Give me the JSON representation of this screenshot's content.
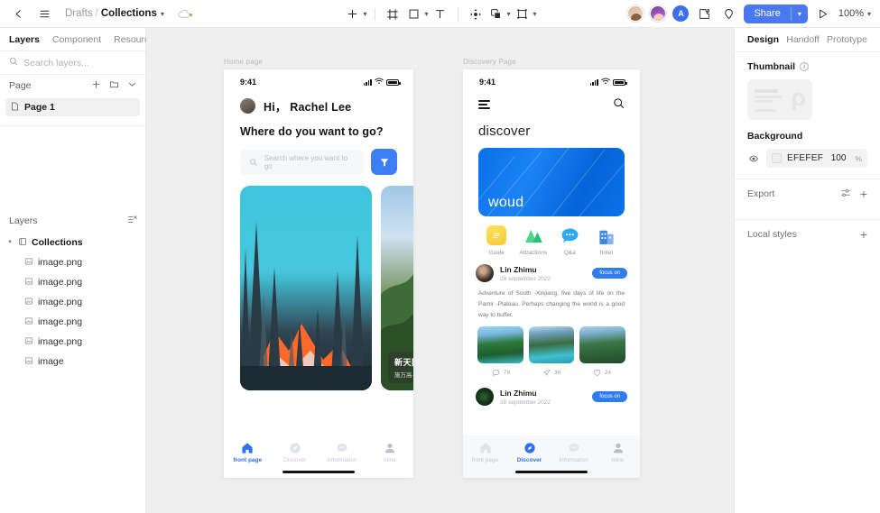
{
  "topbar": {
    "back_icon": "chevron-left-icon",
    "menu_icon": "hamburger-menu-icon",
    "breadcrumb": {
      "drafts": "Drafts",
      "separator": "/",
      "collection": "Collections"
    },
    "cloud_icon": "cloud-sync-icon",
    "tools": [
      {
        "name": "add-tool",
        "glyph": "+",
        "has_caret": true
      },
      {
        "name": "frame-tool",
        "glyph": "frame",
        "has_caret": false
      },
      {
        "name": "shape-tool",
        "glyph": "rect",
        "has_caret": true
      },
      {
        "name": "text-tool",
        "glyph": "T",
        "has_caret": false
      },
      {
        "name": "move-tool",
        "glyph": "move",
        "has_caret": false
      },
      {
        "name": "component-tool",
        "glyph": "layers",
        "has_caret": true
      },
      {
        "name": "slice-tool",
        "glyph": "slice",
        "has_caret": true
      }
    ],
    "avatars": [
      {
        "name": "collaborator-1",
        "initial": ""
      },
      {
        "name": "collaborator-2",
        "initial": ""
      },
      {
        "name": "collaborator-3",
        "initial": "A"
      }
    ],
    "plugin_icon": "puzzle-piece-icon",
    "comment_icon": "comment-pin-icon",
    "share_label": "Share",
    "present_icon": "play-present-icon",
    "zoom_level": "100%"
  },
  "left_panel": {
    "tabs": [
      {
        "label": "Layers",
        "active": true
      },
      {
        "label": "Component",
        "active": false
      },
      {
        "label": "Resource",
        "active": false
      }
    ],
    "search_placeholder": "Search layers...",
    "search_value": "",
    "page_section": {
      "label": "Page"
    },
    "pages": [
      {
        "label": "Page 1"
      }
    ],
    "layers_section": {
      "label": "Layers"
    },
    "layers": [
      {
        "label": "Collections",
        "level": 0,
        "icon": "component-icon"
      },
      {
        "label": "image.png",
        "level": 1,
        "icon": "image-icon"
      },
      {
        "label": "image.png",
        "level": 1,
        "icon": "image-icon"
      },
      {
        "label": "image.png",
        "level": 1,
        "icon": "image-icon"
      },
      {
        "label": "image.png",
        "level": 1,
        "icon": "image-icon"
      },
      {
        "label": "image.png",
        "level": 1,
        "icon": "image-icon"
      },
      {
        "label": "image",
        "level": 1,
        "icon": "image-icon"
      }
    ]
  },
  "canvas": {
    "background": "#EFEFEF",
    "frames": [
      {
        "label": "Home page"
      },
      {
        "label": "Discovery Page"
      }
    ]
  },
  "home_page": {
    "status": {
      "time": "9:41",
      "signal_icon": "cellular-signal-icon",
      "wifi_icon": "wifi-icon",
      "battery_icon": "battery-icon"
    },
    "greeting": "Hi， Rachel Lee",
    "headline": "Where do you want to go?",
    "search_placeholder": "Search where you want to go",
    "filter_icon": "filter-funnel-icon",
    "cards": [
      {
        "name": "mountain-card",
        "title": "",
        "subtitle": ""
      },
      {
        "name": "castle-card",
        "title": "新天鹅堡",
        "subtitle": "施万高·德国"
      }
    ],
    "tabbar": [
      {
        "label": "front page",
        "icon": "home-icon",
        "active": true
      },
      {
        "label": "Discover",
        "icon": "compass-icon",
        "active": false
      },
      {
        "label": "Information",
        "icon": "chat-icon",
        "active": false
      },
      {
        "label": "mine",
        "icon": "person-icon",
        "active": false
      }
    ]
  },
  "discovery_page": {
    "status": {
      "time": "9:41",
      "signal_icon": "cellular-signal-icon",
      "wifi_icon": "wifi-icon",
      "battery_icon": "battery-icon"
    },
    "menu_icon": "hamburger-menu-icon",
    "search_icon": "search-icon",
    "title": "discover",
    "hero_word": "woud",
    "categories": [
      {
        "label": "Guide",
        "icon": "note-icon"
      },
      {
        "label": "Attractions",
        "icon": "mountain-icon"
      },
      {
        "label": "Q&a",
        "icon": "chat-bubble-icon"
      },
      {
        "label": "hotel",
        "icon": "building-icon"
      }
    ],
    "posts": [
      {
        "author": "Lin Zhimu",
        "date": "28 september 2022",
        "chip": "focus on",
        "body": "Adventure of South -Xinjiang, five days of life on the Pamir -Plateau. Perhaps changing the world is a good way to buffer.",
        "stats": [
          {
            "icon": "comment-icon",
            "value": "78"
          },
          {
            "icon": "share-icon",
            "value": "36"
          },
          {
            "icon": "heart-icon",
            "value": "24"
          }
        ]
      },
      {
        "author": "Lin Zhimu",
        "date": "28 september 2022",
        "chip": "focus on",
        "body": "",
        "stats": []
      }
    ],
    "tabbar": [
      {
        "label": "front page",
        "icon": "home-icon",
        "active": false
      },
      {
        "label": "Discover",
        "icon": "compass-icon",
        "active": true
      },
      {
        "label": "Information",
        "icon": "chat-icon",
        "active": false
      },
      {
        "label": "mine",
        "icon": "person-icon",
        "active": false
      }
    ]
  },
  "right_panel": {
    "tabs": [
      {
        "label": "Design",
        "active": true
      },
      {
        "label": "Handoff",
        "active": false
      },
      {
        "label": "Prototype",
        "active": false
      }
    ],
    "thumbnail": {
      "label": "Thumbnail",
      "info_icon": "info-icon"
    },
    "background": {
      "label": "Background",
      "eye_icon": "eye-icon",
      "hex": "EFEFEF",
      "opacity": "100",
      "unit": "%"
    },
    "export": {
      "label": "Export",
      "settings_icon": "sliders-icon",
      "add_icon": "plus-icon"
    },
    "local_styles": {
      "label": "Local styles",
      "add_icon": "plus-icon"
    }
  },
  "colors": {
    "accent": "#4A78F0",
    "canvas_bg": "#EFEFEF",
    "panel_bg": "#FFFFFF",
    "mobile_accent": "#2F6FF0"
  }
}
